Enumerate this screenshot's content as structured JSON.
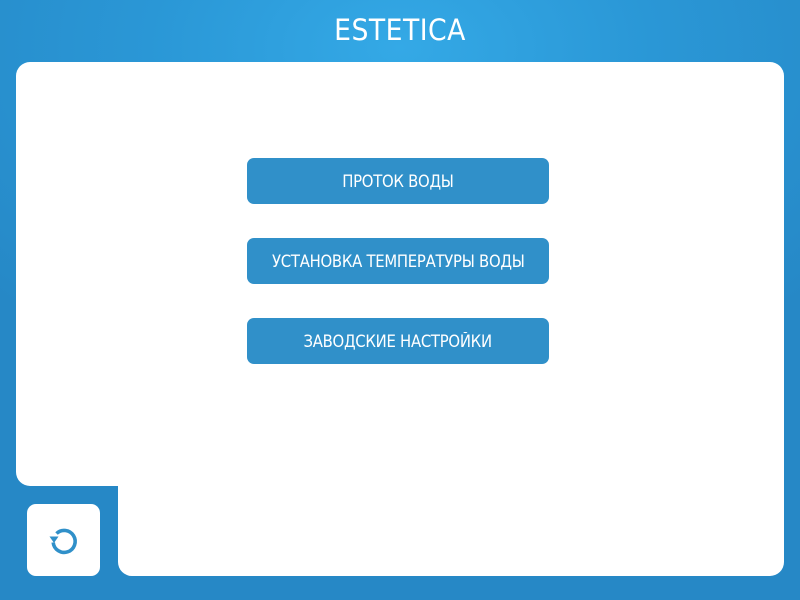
{
  "header": {
    "title": "ESTETICA"
  },
  "menu": {
    "items": [
      {
        "label": "ПРОТОК ВОДЫ"
      },
      {
        "label": "УСТАНОВКА ТЕМПЕРАТУРЫ ВОДЫ"
      },
      {
        "label": "ЗАВОДСКИЕ НАСТРОЙКИ"
      }
    ]
  },
  "footer": {
    "back_icon": "rotate-ccw-icon"
  },
  "colors": {
    "background": "#2a97d6",
    "panel": "#ffffff",
    "button": "#3090c9",
    "text_on_button": "#ffffff"
  }
}
